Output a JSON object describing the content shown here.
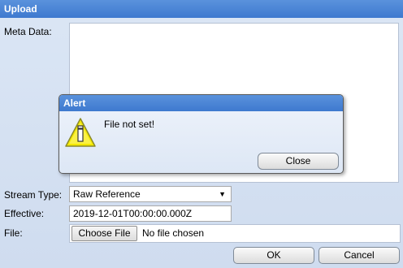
{
  "window": {
    "title": "Upload"
  },
  "form": {
    "meta_label": "Meta Data:",
    "stream_label": "Stream Type:",
    "stream_value": "Raw Reference",
    "effective_label": "Effective:",
    "effective_value": "2019-12-01T00:00:00.000Z",
    "file_label": "File:",
    "choose_file": "Choose File",
    "no_file": "No file chosen"
  },
  "buttons": {
    "ok": "OK",
    "cancel": "Cancel"
  },
  "alert": {
    "title": "Alert",
    "message": "File not set!",
    "close": "Close"
  },
  "colors": {
    "titlebar": "#3e79cf",
    "background": "#dbe6f5",
    "warning": "#f4e800"
  },
  "icons": {
    "alert_icon": "warning-icon",
    "select_arrow": "chevron-down-icon"
  }
}
